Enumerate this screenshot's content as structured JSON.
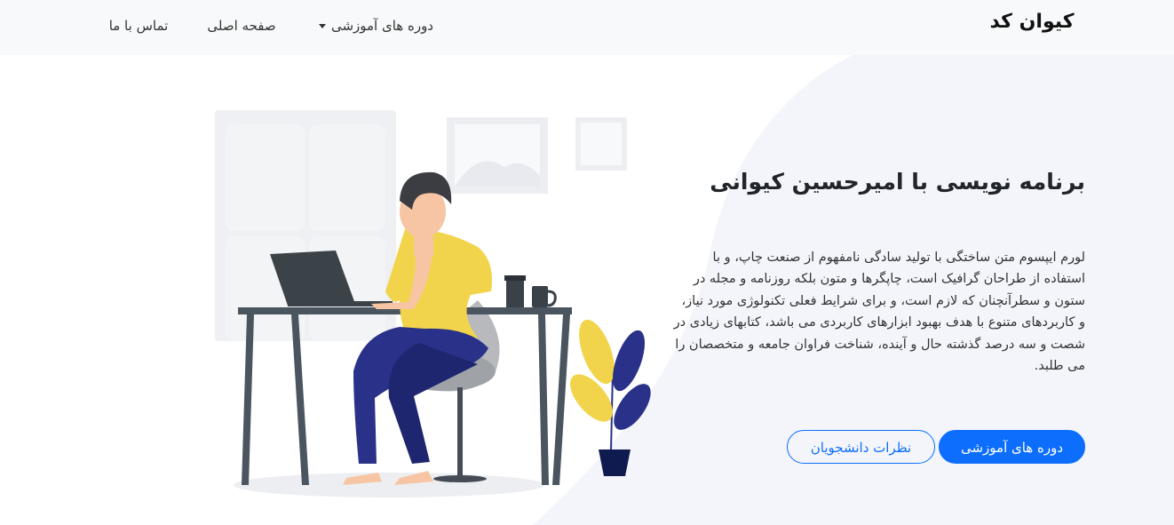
{
  "navbar": {
    "brand": "کیوان کد",
    "items": [
      {
        "label": "دوره های آموزشی",
        "dropdown": true
      },
      {
        "label": "صفحه اصلی"
      },
      {
        "label": "تماس با ما"
      }
    ]
  },
  "hero": {
    "title": "برنامه نویسی با امیرحسین کیوانی",
    "description": "لورم ایپسوم متن ساختگی با تولید سادگی نامفهوم از صنعت چاپ، و با استفاده از طراحان گرافیک است، چاپگرها و متون بلکه روزنامه و مجله در ستون و سطرآنچنان که لازم است، و برای شرایط فعلی تکنولوژی مورد نیاز، و کاربردهای متنوع با هدف بهبود ابزارهای کاربردی می باشد، کتابهای زیادی در شصت و سه درصد گذشته حال و آینده، شناخت فراوان جامعه و متخصصان را می طلبد.",
    "buttons": {
      "primary": "دوره های آموزشی",
      "secondary": "نظرات دانشجویان"
    }
  },
  "colors": {
    "accent": "#0d6efd",
    "navbar_bg": "#f8f9fa",
    "shirt": "#f2d44c",
    "pants": "#2a3188",
    "plant_dark": "#2a3188"
  },
  "icons": {
    "dropdown": "caret-down-icon"
  }
}
